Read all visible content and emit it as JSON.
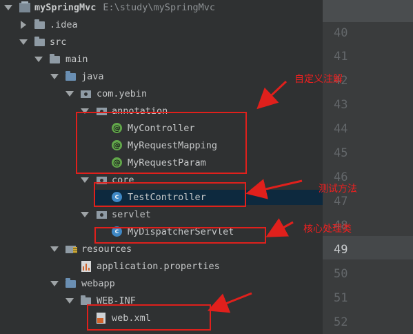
{
  "project": {
    "name": "mySpringMvc",
    "path": "E:\\study\\mySpringMvc"
  },
  "tree": [
    {
      "label": "mySpringMvc",
      "type": "project",
      "open": true
    },
    {
      "label": ".idea",
      "type": "folder",
      "open": false
    },
    {
      "label": "src",
      "type": "folder",
      "open": true
    },
    {
      "label": "main",
      "type": "folder",
      "open": true
    },
    {
      "label": "java",
      "type": "source-folder",
      "open": true
    },
    {
      "label": "com.yebin",
      "type": "package",
      "open": true
    },
    {
      "label": "annotation",
      "type": "package",
      "open": true
    },
    {
      "label": "MyController",
      "type": "annotation"
    },
    {
      "label": "MyRequestMapping",
      "type": "annotation"
    },
    {
      "label": "MyRequestParam",
      "type": "annotation"
    },
    {
      "label": "core",
      "type": "package",
      "open": true
    },
    {
      "label": "TestController",
      "type": "class",
      "selected": true
    },
    {
      "label": "servlet",
      "type": "package",
      "open": true
    },
    {
      "label": "MyDispatcherServlet",
      "type": "class"
    },
    {
      "label": "resources",
      "type": "resources-folder",
      "open": true
    },
    {
      "label": "application.properties",
      "type": "properties"
    },
    {
      "label": "webapp",
      "type": "web-folder",
      "open": true
    },
    {
      "label": "WEB-INF",
      "type": "folder",
      "open": true
    },
    {
      "label": "web.xml",
      "type": "xml"
    }
  ],
  "line_numbers": [
    "40",
    "41",
    "42",
    "43",
    "44",
    "45",
    "46",
    "47",
    "48",
    "49",
    "50",
    "51",
    "52"
  ],
  "current_line": "49",
  "notes": {
    "custom_annotation": "自定义注解",
    "test_method": "测试方法",
    "core_class": "核心处理类"
  },
  "icon_glyphs": {
    "annotation": "@",
    "class": "c"
  },
  "colors": {
    "highlight_box": "#e0201c",
    "note_text": "#f01f1f",
    "selection": "#0d293e"
  }
}
